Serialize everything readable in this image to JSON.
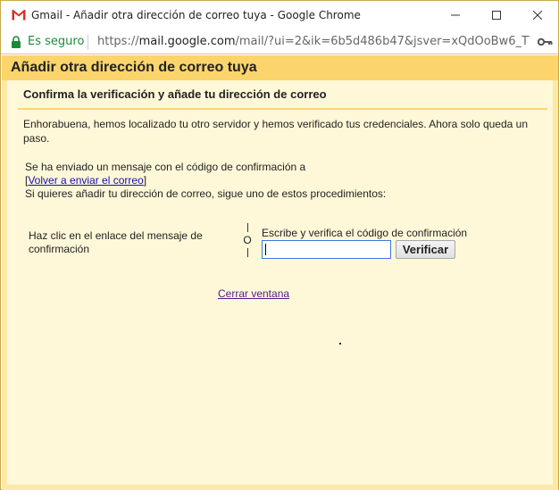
{
  "window": {
    "title": "Gmail - Añadir otra dirección de correo tuya - Google Chrome"
  },
  "addressbar": {
    "secure_label": "Es seguro",
    "url_scheme": "https://",
    "url_host": "mail.google.com",
    "url_rest": "/mail/?ui=2&ik=6b5d486b47&jsver=xQdOoBw6_TY...."
  },
  "dialog": {
    "header_title": "Añadir otra dirección de correo tuya",
    "subtitle": "Confirma la verificación y añade tu dirección de correo",
    "congrats_text": "Enhorabuena, hemos localizado tu otro servidor y hemos verificado tus credenciales. Ahora solo queda un paso.",
    "sent_text": "Se ha enviado un mensaje con el código de confirmación a",
    "resend_open": "[",
    "resend_link": "Volver a enviar el correo",
    "resend_close": "]",
    "procedures_text": "Si quieres añadir tu dirección de correo, sigue uno de estos procedimientos:",
    "option_click_link": "Haz clic en el enlace del mensaje de confirmación",
    "or_label": "O",
    "code_label": "Escribe y verifica el código de confirmación",
    "code_input_value": "",
    "verify_button": "Verificar",
    "close_window_link": "Cerrar ventana"
  },
  "colors": {
    "header_bg": "#fbd56b",
    "content_bg": "#fff8d8",
    "secure_green": "#1a8b3a",
    "link_blue": "#1a0dab",
    "visited_purple": "#551a8b"
  },
  "icons": [
    "gmail-logo-icon",
    "minimize-icon",
    "maximize-icon",
    "close-icon",
    "lock-icon",
    "key-icon"
  ]
}
